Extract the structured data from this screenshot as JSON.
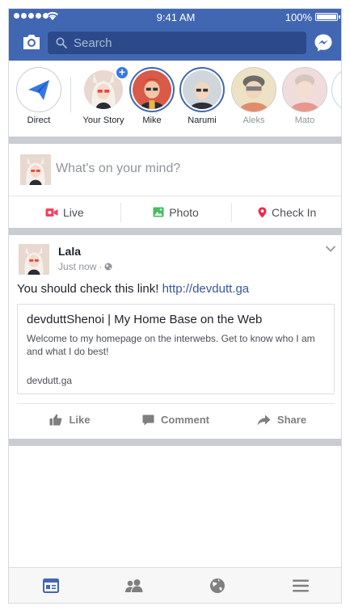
{
  "status_bar": {
    "time": "9:41 AM",
    "battery": "100%"
  },
  "header": {
    "search_placeholder": "Search"
  },
  "stories": [
    {
      "label": "Direct"
    },
    {
      "label": "Your Story"
    },
    {
      "label": "Mike"
    },
    {
      "label": "Narumi"
    },
    {
      "label": "Aleks"
    },
    {
      "label": "Mato"
    }
  ],
  "composer": {
    "placeholder": "What's on your mind?",
    "actions": [
      {
        "label": "Live",
        "icon": "live-video-icon",
        "color": "#f3425f"
      },
      {
        "label": "Photo",
        "icon": "photo-icon",
        "color": "#45bd62"
      },
      {
        "label": "Check In",
        "icon": "check-in-icon",
        "color": "#f02849"
      }
    ]
  },
  "post": {
    "author": "Lala",
    "time": "Just now",
    "text": "You should check this link!",
    "link": "http://devdutt.ga",
    "card": {
      "title": "devduttShenoi | My Home Base on the Web",
      "description": "Welcome to my homepage on the interwebs. Get to know who I am\nand what I do best!",
      "domain": "devdutt.ga"
    },
    "actions": [
      {
        "label": "Like",
        "icon": "thumbs-up-icon"
      },
      {
        "label": "Comment",
        "icon": "comment-icon"
      },
      {
        "label": "Share",
        "icon": "share-arrow-icon"
      }
    ]
  },
  "bottom_nav": [
    {
      "icon": "news-feed-icon",
      "active": true
    },
    {
      "icon": "friends-icon",
      "active": false
    },
    {
      "icon": "globe-icon",
      "active": false
    },
    {
      "icon": "menu-icon",
      "active": false
    }
  ],
  "colors": {
    "brand": "#4267b2",
    "accent": "#3578e5",
    "link": "#365899"
  }
}
